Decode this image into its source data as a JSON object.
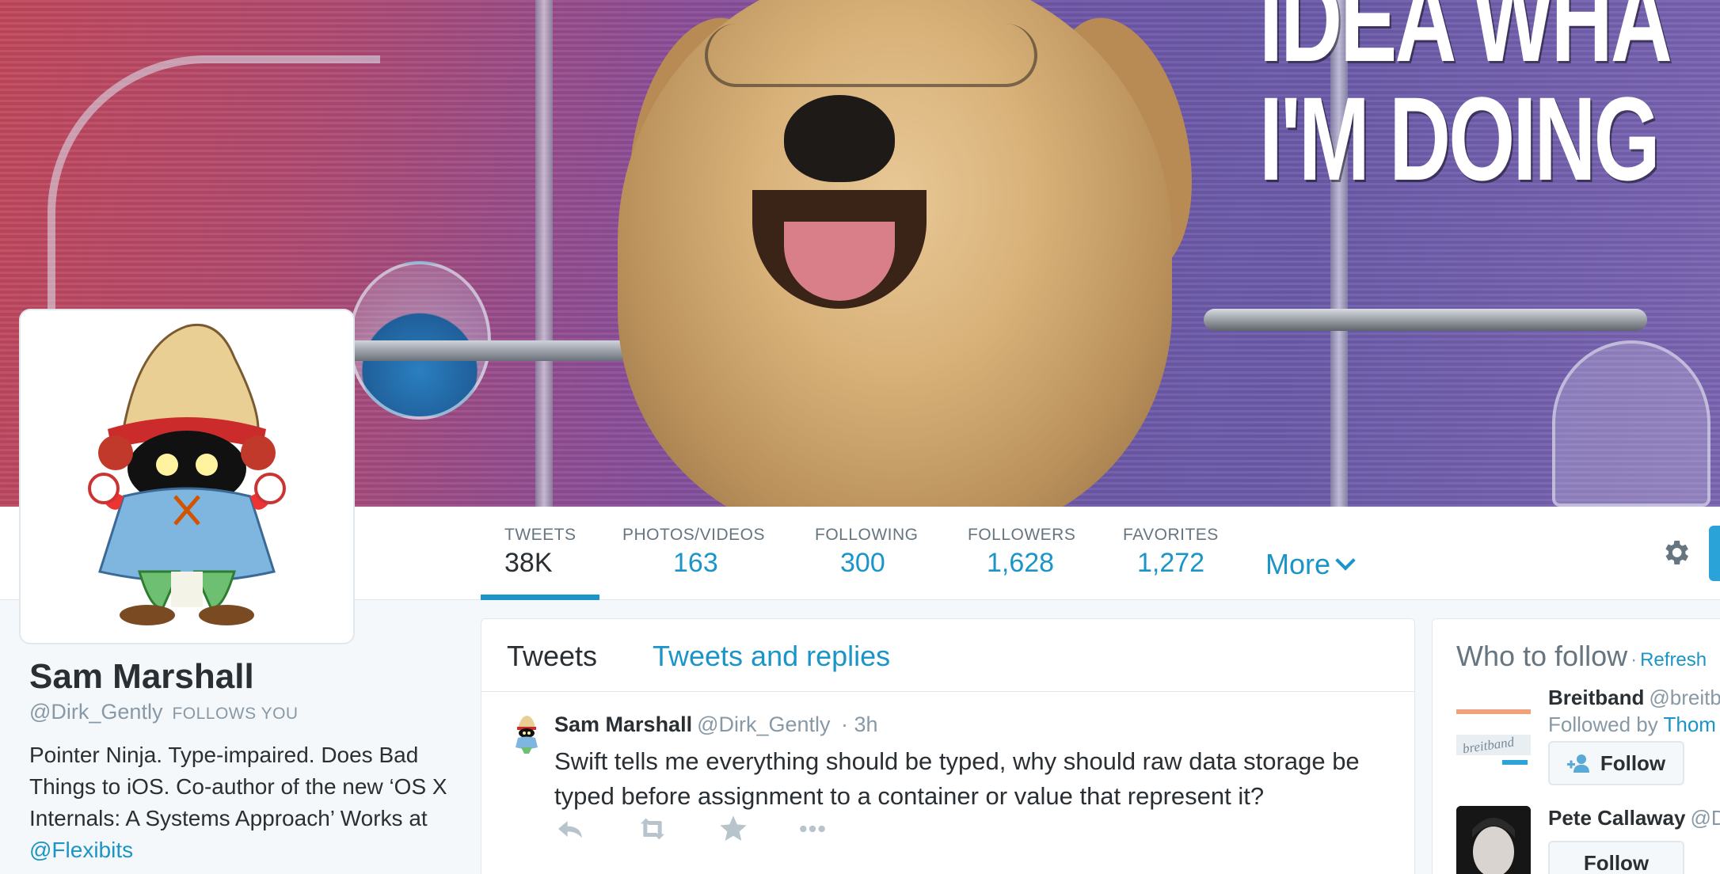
{
  "banner": {
    "meme_line1": "IDEA WHA",
    "meme_line2": "I'M DOING"
  },
  "nav": {
    "stats": [
      {
        "label": "TWEETS",
        "value": "38K"
      },
      {
        "label": "PHOTOS/VIDEOS",
        "value": "163"
      },
      {
        "label": "FOLLOWING",
        "value": "300"
      },
      {
        "label": "FOLLOWERS",
        "value": "1,628"
      },
      {
        "label": "FAVORITES",
        "value": "1,272"
      }
    ],
    "more_label": "More",
    "active_index": 0
  },
  "profile": {
    "name": "Sam Marshall",
    "handle": "@Dirk_Gently",
    "follows_you": "FOLLOWS YOU",
    "bio": "Pointer Ninja. Type-impaired. Does Bad Things to iOS. Co-author of the new ‘OS X Internals: A Systems Approach’ Works at",
    "bio_link": "@Flexibits"
  },
  "timeline": {
    "tabs": [
      "Tweets",
      "Tweets and replies"
    ],
    "tweet": {
      "name": "Sam Marshall",
      "handle": "@Dirk_Gently",
      "time": "· 3h",
      "text": "Swift tells me everything should be typed, why should raw data storage be typed before assignment to a container or value that represent it?"
    }
  },
  "who_to_follow": {
    "title": "Who to follow",
    "refresh": "Refresh",
    "items": [
      {
        "name": "Breitband",
        "handle": "@breitb",
        "sub_prefix": "Followed by",
        "sub_link": "Thom",
        "button": "Follow",
        "pic_text": "breitband"
      },
      {
        "name": "Pete Callaway",
        "handle": "@D",
        "button": "Follow"
      }
    ]
  },
  "colors": {
    "accent": "#1b95c7",
    "text": "#292f33",
    "muted": "#8899a6"
  }
}
